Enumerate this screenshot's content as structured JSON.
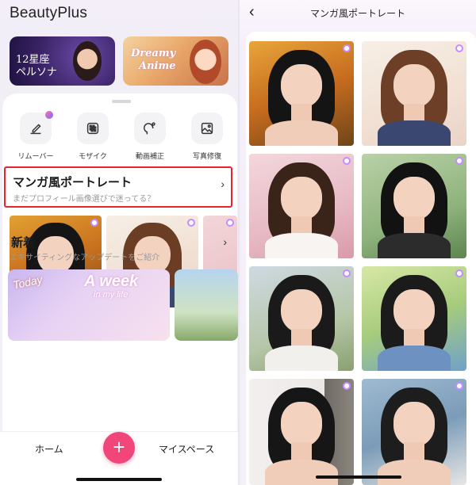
{
  "app": {
    "title": "BeautyPlus"
  },
  "banners": [
    {
      "text": "12星座\nペルソナ",
      "line1": "12星座",
      "line2": "ペルソナ"
    },
    {
      "line1": "Dreamy",
      "line2": "Anime"
    }
  ],
  "tools": [
    {
      "label": "リムーバー",
      "icon": "eraser-icon"
    },
    {
      "label": "モザイク",
      "icon": "mosaic-icon"
    },
    {
      "label": "動画補正",
      "icon": "face-retouch-icon"
    },
    {
      "label": "写真修復",
      "icon": "photo-restore-icon"
    }
  ],
  "manga_section": {
    "title": "マンガ風ポートレート",
    "subtitle": "まだプロフィール画像選びで迷ってる？"
  },
  "new_section": {
    "title": "新着",
    "subtitle": "エキサイティングなアップデートをご紹介"
  },
  "promo": {
    "line1": "Today",
    "line2": "A week",
    "line3": "in my life"
  },
  "tabbar": {
    "home": "ホーム",
    "add": "+",
    "my_space": "マイスペース"
  },
  "detail": {
    "title": "マンガ風ポートレート"
  },
  "colors": {
    "accent": "#f0467a",
    "highlight": "#e8232d"
  }
}
